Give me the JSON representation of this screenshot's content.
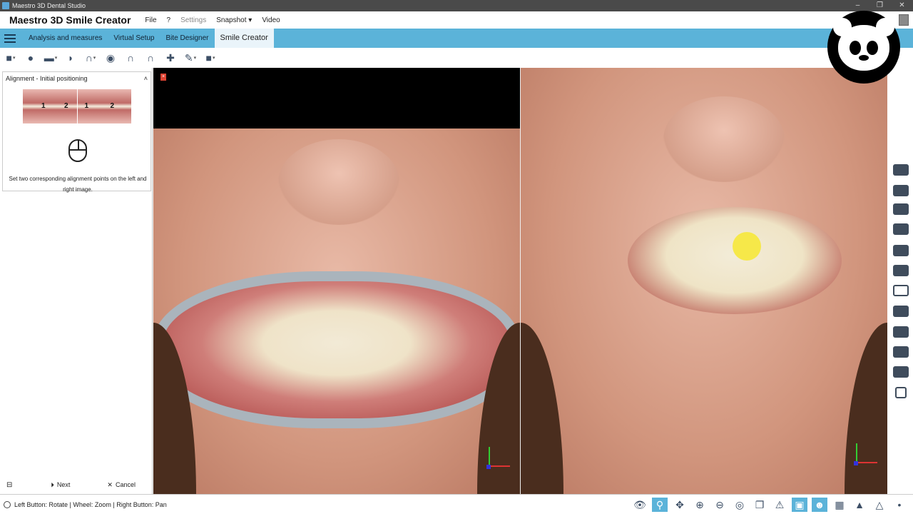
{
  "window": {
    "title": "Maestro 3D Dental Studio"
  },
  "menubar": {
    "app_title": "Maestro 3D Smile Creator",
    "items": [
      "File",
      "?",
      "Settings",
      "Snapshot",
      "Video"
    ]
  },
  "ribbon": {
    "tabs": [
      "Analysis and measures",
      "Virtual Setup",
      "Bite Designer",
      "Smile Creator"
    ],
    "active_tab": "Smile Creator"
  },
  "sidebar": {
    "panel_title": "Alignment - Initial positioning",
    "thumb_labels": [
      "1",
      "2",
      "1",
      "2"
    ],
    "hint": "Set two corresponding alignment points on the left and right image.",
    "next_label": "Next",
    "cancel_label": "Cancel"
  },
  "statusbar": {
    "text": "Left Button: Rotate | Wheel: Zoom | Right Button: Pan"
  },
  "icons": {
    "toolbar": [
      "layers-icon",
      "head-icon",
      "teeth-row-icon",
      "gum-icon",
      "arch-icon",
      "tooth-icon",
      "arch-outline-icon",
      "arch-outline-icon-2",
      "implant-icon",
      "pen-icon",
      "square-icon"
    ],
    "status": [
      "eye-icon",
      "select-tooth-icon",
      "move-icon",
      "zoom-in-icon",
      "zoom-out-icon",
      "target-icon",
      "copy-icon",
      "warning-icon",
      "image-icon",
      "person-icon",
      "grid-icon",
      "triangle-icon",
      "triangle-outline-icon",
      "dot-icon"
    ]
  },
  "colors": {
    "ribbon": "#5bb3d9",
    "cursor_highlight": "#f6e83a"
  }
}
